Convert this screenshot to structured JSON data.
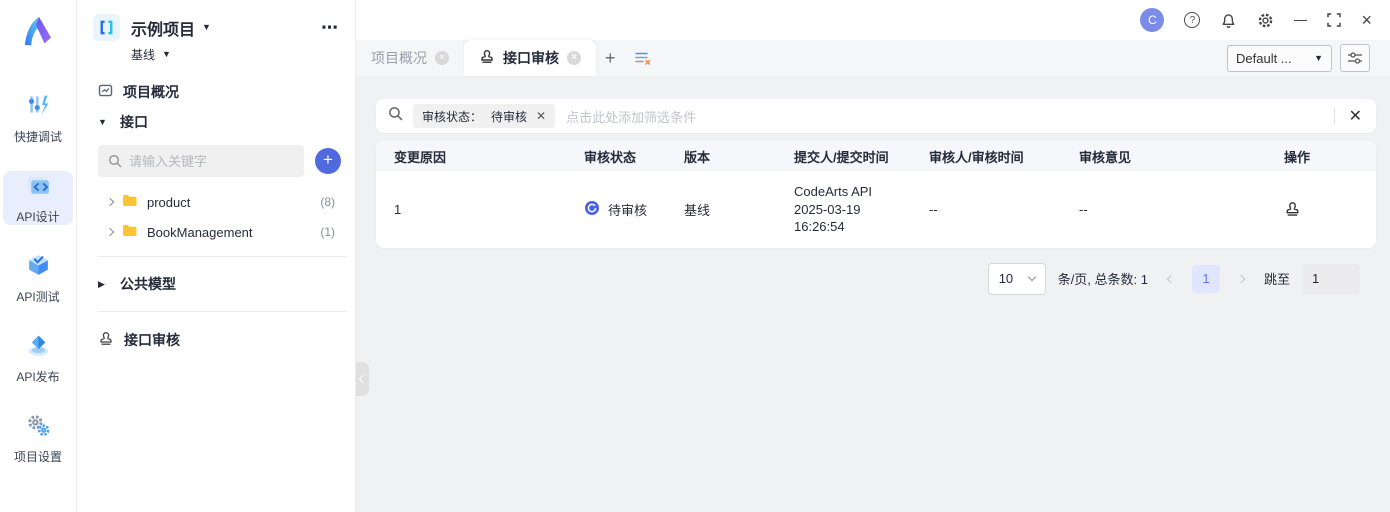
{
  "colors": {
    "accent_blue": "#4a62e8",
    "folder_yellow": "#fbc432",
    "avatar_bg": "#7b8ce8",
    "active_page_bg": "#e0e6fd",
    "rail_active_bg": "#e8eefb"
  },
  "left_rail": {
    "items": [
      {
        "label": "快捷调试"
      },
      {
        "label": "API设计"
      },
      {
        "label": "API测试"
      },
      {
        "label": "API发布"
      },
      {
        "label": "项目设置"
      }
    ]
  },
  "project_panel": {
    "project_name": "示例项目",
    "branch": "基线",
    "overview_label": "项目概况",
    "section_label": "接口",
    "search_placeholder": "请输入关键字",
    "tree": [
      {
        "name": "product",
        "count": "(8)"
      },
      {
        "name": "BookManagement",
        "count": "(1)"
      }
    ],
    "common_model_label": "公共模型",
    "review_label": "接口审核"
  },
  "topbar": {
    "avatar": "C"
  },
  "tabs": [
    {
      "label": "项目概况"
    },
    {
      "label": "接口审核"
    }
  ],
  "env_select": {
    "value": "Default ..."
  },
  "filter": {
    "chip_label": "审核状态：",
    "chip_value": "待审核",
    "placeholder": "点击此处添加筛选条件"
  },
  "table": {
    "columns": [
      "变更原因",
      "审核状态",
      "版本",
      "提交人/提交时间",
      "审核人/审核时间",
      "审核意见",
      "操作"
    ],
    "rows": [
      {
        "reason": "1",
        "status": "待审核",
        "version": "基线",
        "submitter": "CodeArts API",
        "submit_date": "2025-03-19",
        "submit_time": "16:26:54",
        "reviewer": "--",
        "opinion": "--"
      }
    ]
  },
  "pagination": {
    "page_size": "10",
    "summary": "条/页, 总条数: 1",
    "current_page": "1",
    "jump_label": "跳至",
    "jump_value": "1"
  }
}
